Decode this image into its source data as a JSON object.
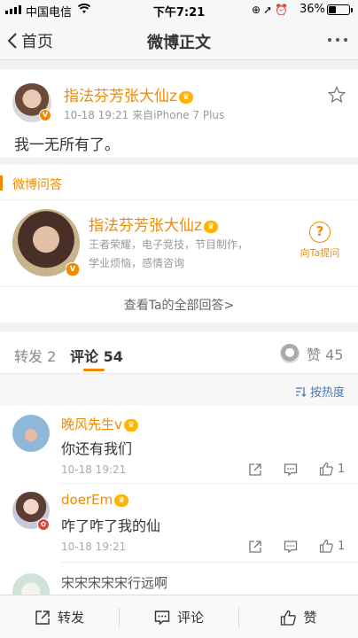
{
  "status_bar": {
    "carrier": "中国电信",
    "time": "下午7:21",
    "battery_percent": "36%",
    "battery_level": 0.36,
    "icons": [
      "signal-icon",
      "wifi-icon",
      "lock-rotation-icon",
      "location-icon",
      "alarm-icon",
      "battery-icon"
    ]
  },
  "nav": {
    "back_label": "首页",
    "title": "微博正文",
    "more_icon": "more-icon"
  },
  "post": {
    "author": "指法芬芳张大仙z",
    "meta": "10-18 19:21  来自iPhone 7 Plus",
    "text": "我一无所有了。"
  },
  "qa": {
    "header": "微博问答",
    "name": "指法芬芳张大仙z",
    "description": "王者荣耀，电子竞技，节目制作，学业烦恼，感情咨询",
    "ask_label": "向Ta提问",
    "view_all": "查看Ta的全部回答>"
  },
  "tabs": {
    "repost": "转发 2",
    "comment_label": "评论",
    "comment_count": "54",
    "like_label": "赞 45"
  },
  "sort": {
    "label": "按热度"
  },
  "comments": [
    {
      "name": "晚风先生v",
      "text": "你还有我们",
      "time": "10-18 19:21",
      "likes": "1"
    },
    {
      "name": "doerEm",
      "text": "咋了咋了我的仙",
      "time": "10-18 19:21",
      "likes": "1"
    },
    {
      "name": "",
      "text": "宋宋宋宋宋行远啊",
      "time": "",
      "likes": ""
    }
  ],
  "bottom_bar": {
    "repost": "转发",
    "comment": "评论",
    "like": "赞"
  },
  "colors": {
    "accent": "#f08a00",
    "link_blue": "#4a7ab5"
  }
}
